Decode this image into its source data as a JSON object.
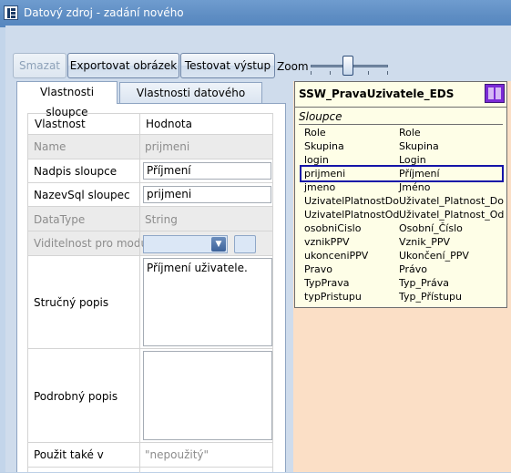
{
  "window": {
    "title": "Datový zdroj - zadání nového"
  },
  "toolbar": {
    "delete_label": "Smazat",
    "export_label": "Exportovat obrázek",
    "test_label": "Testovat výstup",
    "zoom_label": "Zoom"
  },
  "tabs": [
    {
      "label": "Vlastnosti sloupce",
      "active": true
    },
    {
      "label": "Vlastnosti datového zdroje",
      "active": false
    }
  ],
  "grid": {
    "col_property": "Vlastnost",
    "col_value": "Hodnota",
    "rows": [
      {
        "name": "Name",
        "value": "prijmeni",
        "readonly": true
      },
      {
        "name": "Nadpis sloupce",
        "value": "Příjmení"
      },
      {
        "name": "NazevSql sloupec",
        "value": "prijmeni"
      },
      {
        "name": "DataType",
        "value": "String",
        "readonly": true
      },
      {
        "name": "Viditelnost pro modul",
        "value": "",
        "readonly": true
      },
      {
        "name": "Stručný popis",
        "value": "Příjmení uživatele."
      },
      {
        "name": "Podrobný popis",
        "value": ""
      },
      {
        "name": "Použit také v",
        "value": "\"nepoužitý\""
      }
    ]
  },
  "entity": {
    "title": "SSW_PravaUzivatele_EDS",
    "section": "Sloupce",
    "fields": [
      {
        "column": "Role",
        "caption": "Role"
      },
      {
        "column": "Skupina",
        "caption": "Skupina"
      },
      {
        "column": "login",
        "caption": "Login"
      },
      {
        "column": "prijmeni",
        "caption": "Příjmení",
        "selected": true
      },
      {
        "column": "jmeno",
        "caption": "Jméno"
      },
      {
        "column": "UzivatelPlatnostDo",
        "caption": "Uživatel_Platnost_Do"
      },
      {
        "column": "UzivatelPlatnostOd",
        "caption": "Uživatel_Platnost_Od"
      },
      {
        "column": "osobniCislo",
        "caption": "Osobní_Číslo"
      },
      {
        "column": "vznikPPV",
        "caption": "Vznik_PPV"
      },
      {
        "column": "ukonceniPPV",
        "caption": "Ukončení_PPV"
      },
      {
        "column": "Pravo",
        "caption": "Právo"
      },
      {
        "column": "TypPrava",
        "caption": "Typ_Práva"
      },
      {
        "column": "typPristupu",
        "caption": "Typ_Přístupu"
      }
    ]
  },
  "colors": {
    "titlebar": "#5e8dc3",
    "canvas": "#fbdfc6",
    "entity_bg": "#fefee7",
    "selection": "#1414a8",
    "badge": "#7b2ad6"
  }
}
